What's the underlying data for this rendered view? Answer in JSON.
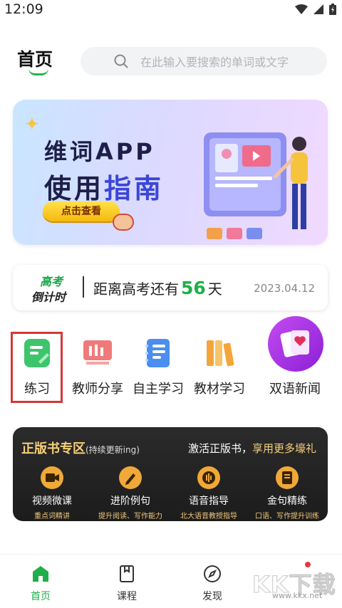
{
  "status_bar": {
    "time": "12:09"
  },
  "header": {
    "title": "首页",
    "search_placeholder": "在此输入要搜索的单词或文字"
  },
  "banner": {
    "line1": "维词APP",
    "line2a": "使用",
    "line2b": "指南",
    "button": "点击查看"
  },
  "countdown": {
    "logo_line1": "高考",
    "logo_line2": "倒计时",
    "prefix": "距离高考还有",
    "days": "56",
    "suffix": "天",
    "date": "2023.04.12"
  },
  "features": [
    {
      "label": "练习",
      "icon": "practice-icon",
      "color": "#3ec46d"
    },
    {
      "label": "教师分享",
      "icon": "teacher-share-icon",
      "color": "#f07a7a"
    },
    {
      "label": "自主学习",
      "icon": "self-study-icon",
      "color": "#4a8ef0"
    },
    {
      "label": "教材学习",
      "icon": "textbook-icon",
      "color": "#f3a53b"
    },
    {
      "label": "双语新闻",
      "icon": "bilingual-news-icon",
      "color": "#a12ce0"
    }
  ],
  "books": {
    "title": "正版书专区",
    "title_note": "(持续更新ing)",
    "promo_a": "激活正版书，",
    "promo_b": "享用更多壕礼",
    "items": [
      {
        "title": "视频微课",
        "sub": "重点词精讲",
        "icon": "video-icon"
      },
      {
        "title": "进阶例句",
        "sub": "提升阅读、写作能力",
        "icon": "pen-icon"
      },
      {
        "title": "语音指导",
        "sub": "北大语音教授指导",
        "icon": "voice-icon"
      },
      {
        "title": "金句精练",
        "sub": "口语、写作提升训练",
        "icon": "book-icon"
      }
    ]
  },
  "tabs": [
    {
      "label": "首页",
      "icon": "home-icon",
      "active": true
    },
    {
      "label": "课程",
      "icon": "course-icon",
      "active": false
    },
    {
      "label": "发现",
      "icon": "compass-icon",
      "active": false
    }
  ],
  "watermark": {
    "text": "KK下载",
    "url": "www.kkx.net"
  },
  "colors": {
    "accent": "#1fae4a",
    "highlight_border": "#d43838",
    "gold": "#f5d07b"
  }
}
